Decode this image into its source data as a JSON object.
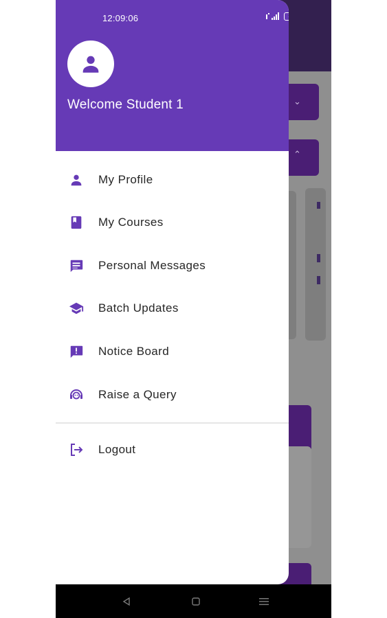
{
  "status_bar": {
    "time": "12:09:06",
    "battery": "100"
  },
  "drawer": {
    "greeting": "Welcome Student 1",
    "accent_color": "#663ab6",
    "menu": [
      {
        "label": "My Profile",
        "icon": "person-icon"
      },
      {
        "label": "My Courses",
        "icon": "book-icon"
      },
      {
        "label": "Personal Messages",
        "icon": "message-icon"
      },
      {
        "label": "Batch Updates",
        "icon": "school-icon"
      },
      {
        "label": "Notice Board",
        "icon": "announcement-icon"
      },
      {
        "label": "Raise a Query",
        "icon": "support-agent-icon"
      }
    ],
    "logout": {
      "label": "Logout",
      "icon": "logout-icon"
    }
  },
  "nav_bar": {
    "icons": [
      "back-icon",
      "home-icon",
      "recents-icon"
    ]
  }
}
